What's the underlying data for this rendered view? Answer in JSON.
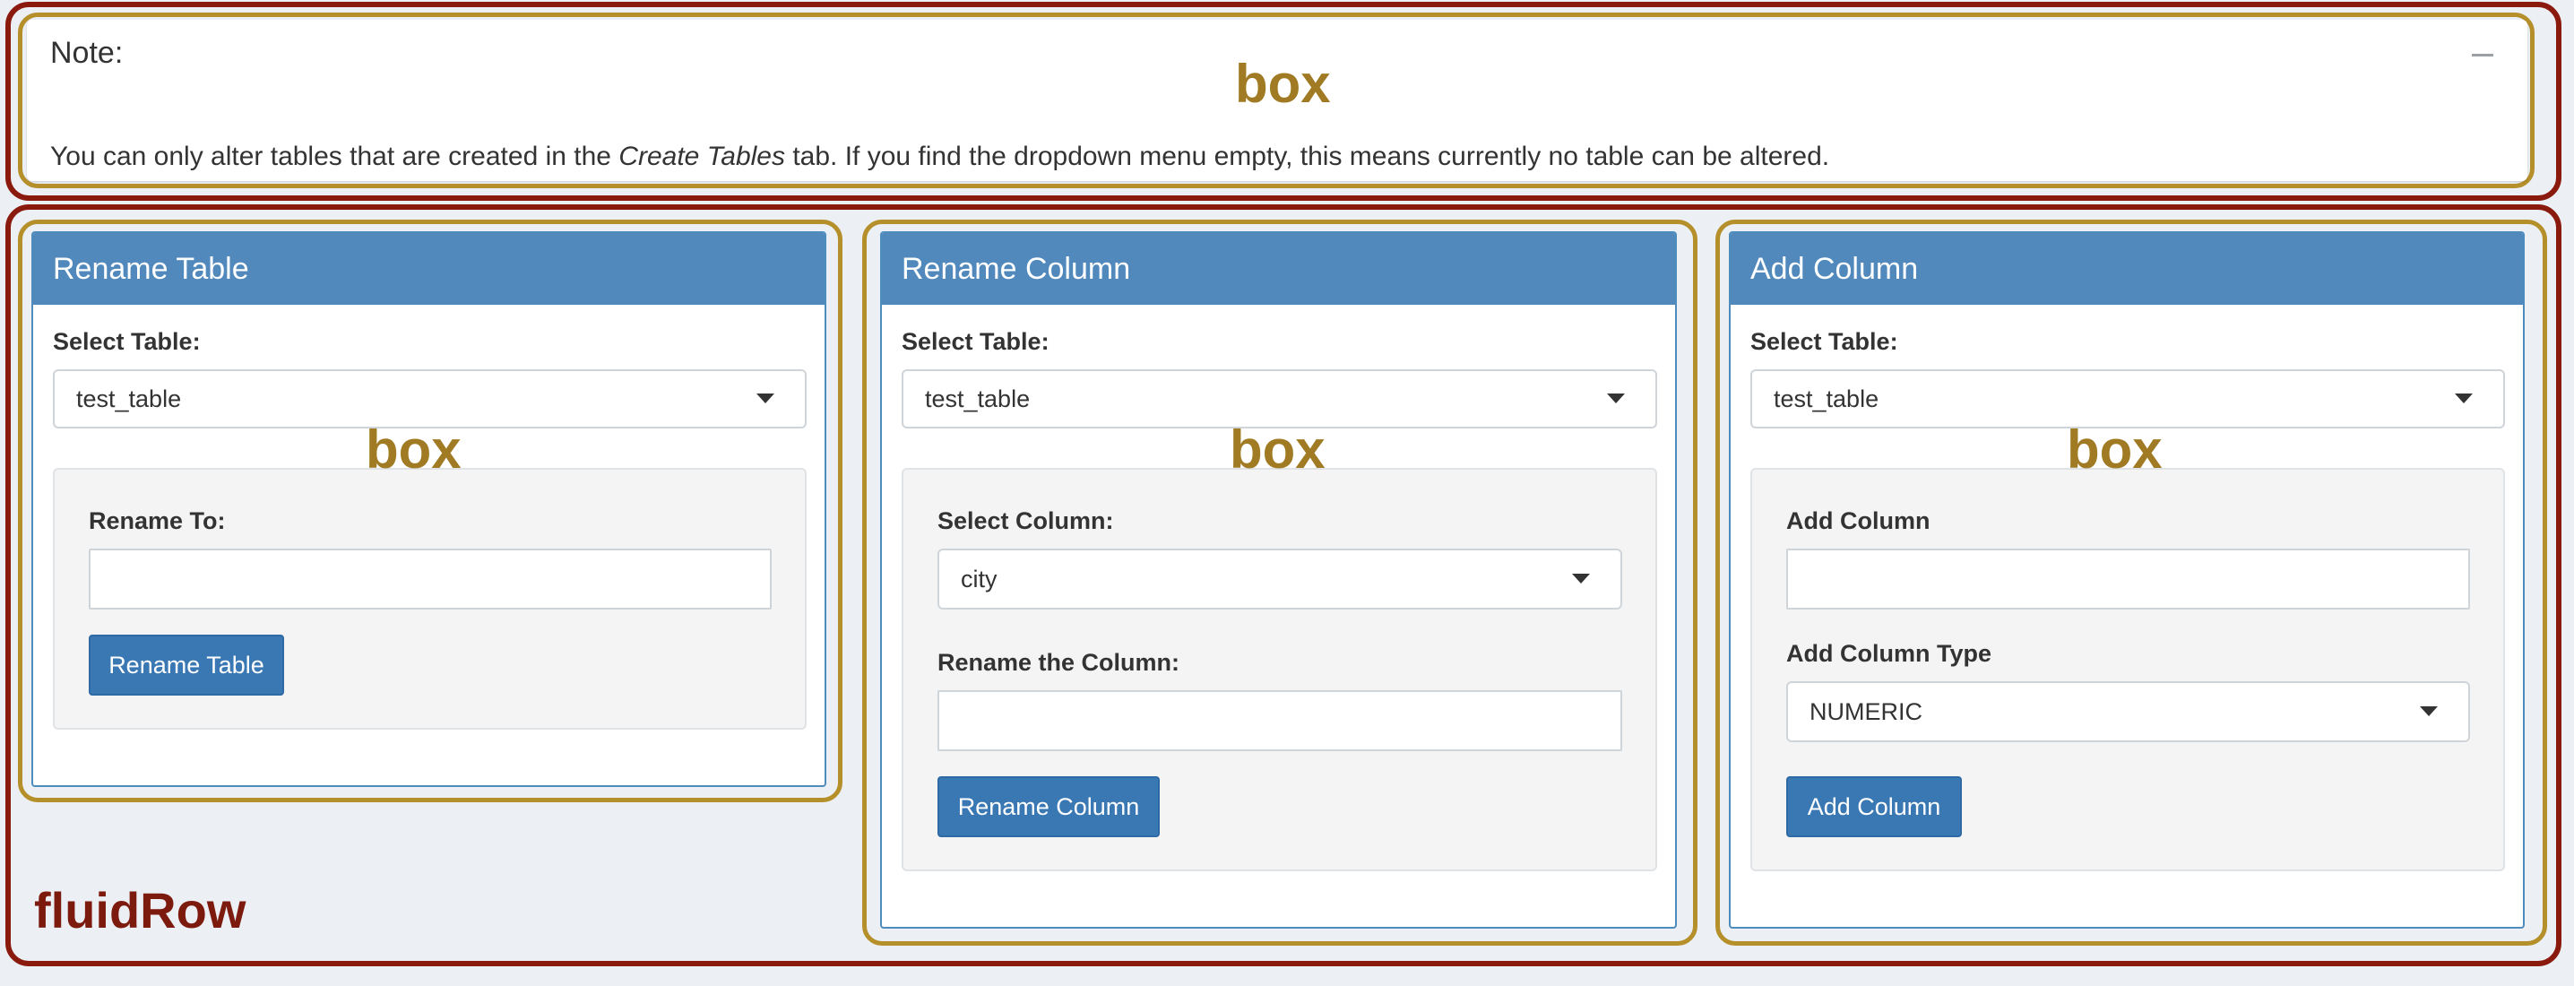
{
  "annotations": {
    "box_label": "box",
    "row_label": "fluidRow"
  },
  "note": {
    "title": "Note:",
    "text_before": "You can only alter tables that are created in the ",
    "text_em": "Create Tables",
    "text_after": " tab. If you find the dropdown menu empty, this means currently no table can be altered.",
    "collapse_icon": "minus-icon"
  },
  "rename_table": {
    "title": "Rename Table",
    "select_label": "Select Table:",
    "select_value": "test_table",
    "rename_label": "Rename To:",
    "rename_value": "",
    "button": "Rename Table"
  },
  "rename_column": {
    "title": "Rename Column",
    "select_label": "Select Table:",
    "select_value": "test_table",
    "column_label": "Select Column:",
    "column_value": "city",
    "rename_label": "Rename the Column:",
    "rename_value": "",
    "button": "Rename Column"
  },
  "add_column": {
    "title": "Add Column",
    "select_label": "Select Table:",
    "select_value": "test_table",
    "name_label": "Add Column",
    "name_value": "",
    "type_label": "Add Column Type",
    "type_value": "NUMERIC",
    "button": "Add Column"
  },
  "colors": {
    "header_blue": "#5189bc",
    "button_blue": "#3a78b4",
    "row_outline": "#8b1a0e",
    "box_outline": "#b48f2a"
  }
}
